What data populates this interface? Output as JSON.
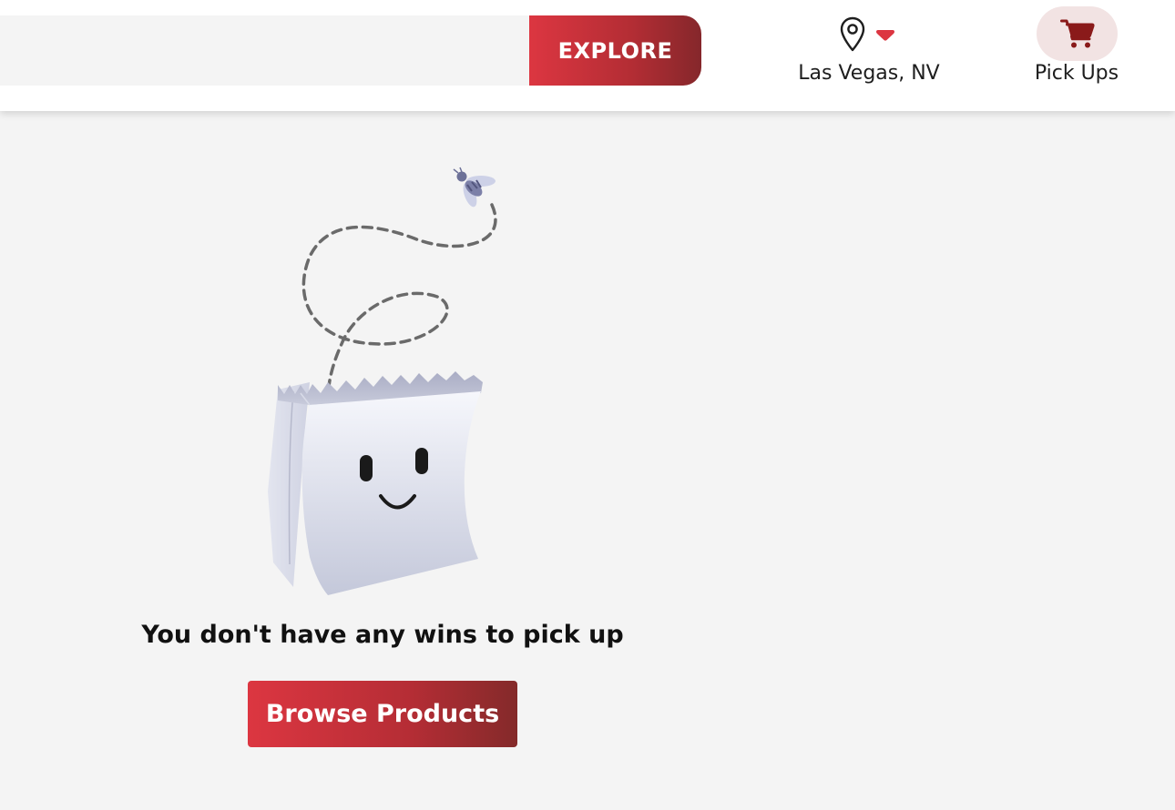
{
  "header": {
    "search": {
      "value": "",
      "placeholder": ""
    },
    "explore_label": "EXPLORE",
    "location": {
      "label": "Las Vegas, NV",
      "icon": "map-pin-icon",
      "dropdown_icon": "caret-down-icon"
    },
    "pickups": {
      "label": "Pick Ups",
      "icon": "shopping-cart-icon"
    }
  },
  "empty_state": {
    "illustration": "smiling-paper-bag-with-bee",
    "message": "You don't have any wins to pick up",
    "cta_label": "Browse Products"
  },
  "colors": {
    "accent_start": "#dc3641",
    "accent_end": "#842a2a",
    "cart_bg": "#f2e3e3",
    "cart_icon": "#8a1a1a",
    "page_bg": "#f4f4f4"
  }
}
